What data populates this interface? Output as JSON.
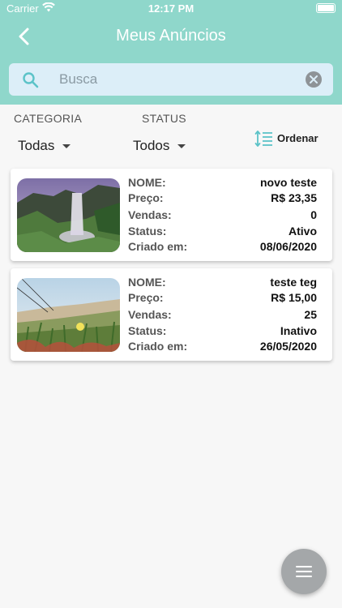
{
  "status_bar": {
    "carrier": "Carrier",
    "time": "12:17 PM"
  },
  "header": {
    "title": "Meus Anúncios",
    "back_icon": "chevron-left-icon"
  },
  "search": {
    "placeholder": "Busca",
    "value": ""
  },
  "filters": {
    "category_label": "CATEGORIA",
    "category_value": "Todas",
    "status_label": "STATUS",
    "status_value": "Todos",
    "sort_label": "Ordenar"
  },
  "field_labels": {
    "name": "NOME:",
    "price": "Preço:",
    "sales": "Vendas:",
    "status": "Status:",
    "created": "Criado em:"
  },
  "listings": [
    {
      "name": "novo teste",
      "price": "R$ 23,35",
      "sales": "0",
      "status": "Ativo",
      "created": "08/06/2020",
      "image": "waterfall-photo"
    },
    {
      "name": "teste teg",
      "price": "R$ 15,00",
      "sales": "25",
      "status": "Inativo",
      "created": "26/05/2020",
      "image": "grass-flower-photo"
    }
  ],
  "fab": {
    "icon": "menu-icon"
  },
  "colors": {
    "header": "#8fd7cb",
    "search_bg": "#dceef8",
    "accent": "#5cc3c8"
  }
}
